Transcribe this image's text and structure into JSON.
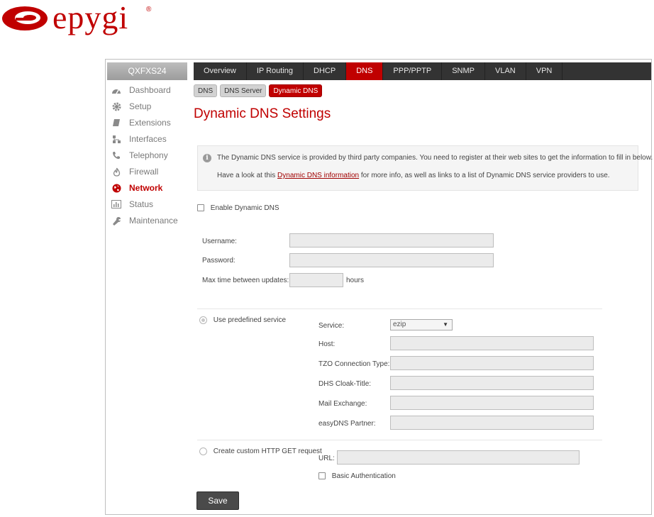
{
  "logo": {
    "text": "epygi",
    "reg": "®"
  },
  "device": {
    "name": "QXFXS24"
  },
  "sidebar": {
    "items": [
      {
        "label": "Dashboard",
        "icon": "dashboard-icon"
      },
      {
        "label": "Setup",
        "icon": "gear-icon"
      },
      {
        "label": "Extensions",
        "icon": "book-icon"
      },
      {
        "label": "Interfaces",
        "icon": "network-nodes-icon"
      },
      {
        "label": "Telephony",
        "icon": "phone-icon"
      },
      {
        "label": "Firewall",
        "icon": "flame-icon"
      },
      {
        "label": "Network",
        "icon": "globe-icon",
        "active": true
      },
      {
        "label": "Status",
        "icon": "bar-chart-icon"
      },
      {
        "label": "Maintenance",
        "icon": "wrench-icon"
      }
    ]
  },
  "topnav": {
    "tabs": [
      {
        "label": "Overview"
      },
      {
        "label": "IP Routing"
      },
      {
        "label": "DHCP"
      },
      {
        "label": "DNS",
        "active": true
      },
      {
        "label": "PPP/PPTP"
      },
      {
        "label": "SNMP"
      },
      {
        "label": "VLAN"
      },
      {
        "label": "VPN"
      }
    ]
  },
  "subtabs": [
    {
      "label": "DNS"
    },
    {
      "label": "DNS Server"
    },
    {
      "label": "Dynamic DNS",
      "active": true
    }
  ],
  "page": {
    "title": "Dynamic DNS Settings"
  },
  "info": {
    "line1": "The Dynamic DNS service is provided by third party companies. You need to register at their web sites to get the information to fill in below.",
    "line2_prefix": "Have a look at this ",
    "line2_link": "Dynamic DNS information",
    "line2_suffix": " for more info, as well as links to a list of Dynamic DNS service providers to use."
  },
  "form": {
    "enable_label": "Enable Dynamic DNS",
    "enable_checked": false,
    "username_label": "Username:",
    "username_value": "",
    "password_label": "Password:",
    "password_value": "",
    "maxtime_label": "Max time between updates:",
    "maxtime_value": "",
    "maxtime_unit": "hours",
    "predefined_label": "Use predefined service",
    "predefined_selected": true,
    "service_label": "Service:",
    "service_value": "ezip",
    "host_label": "Host:",
    "host_value": "",
    "tzo_label": "TZO Connection Type:",
    "tzo_value": "",
    "dhs_label": "DHS Cloak-Title:",
    "dhs_value": "",
    "mail_label": "Mail Exchange:",
    "mail_value": "",
    "easydns_label": "easyDNS Partner:",
    "easydns_value": "",
    "custom_label": "Create custom HTTP GET request",
    "custom_selected": false,
    "url_label": "URL:",
    "url_value": "",
    "basic_auth_label": "Basic Authentication",
    "basic_auth_checked": false
  },
  "buttons": {
    "save": "Save"
  },
  "colors": {
    "accent": "#c00000",
    "nav_bg": "#333333",
    "sidebar_text": "#7a7a7a"
  }
}
